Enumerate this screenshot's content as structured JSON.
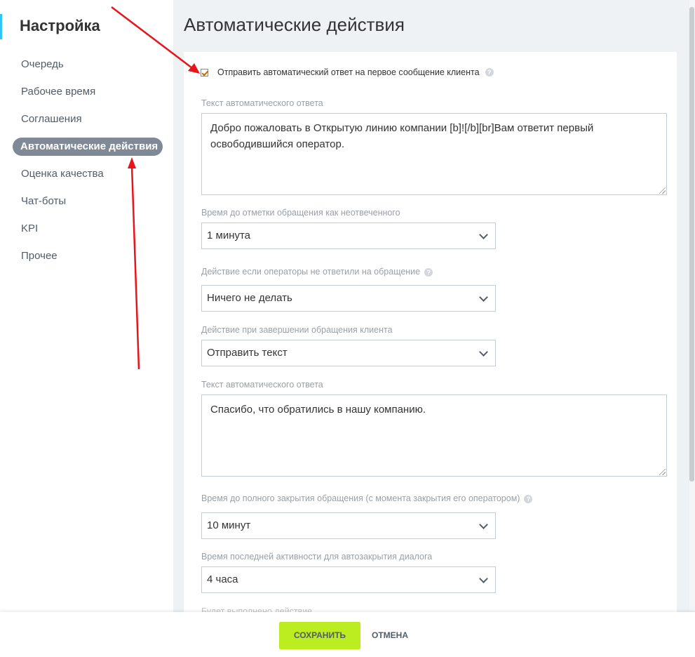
{
  "sidebar": {
    "title": "Настройка",
    "items": [
      {
        "label": "Очередь",
        "active": false
      },
      {
        "label": "Рабочее время",
        "active": false
      },
      {
        "label": "Соглашения",
        "active": false
      },
      {
        "label": "Автоматические действия",
        "active": true
      },
      {
        "label": "Оценка качества",
        "active": false
      },
      {
        "label": "Чат-боты",
        "active": false
      },
      {
        "label": "KPI",
        "active": false
      },
      {
        "label": "Прочее",
        "active": false
      }
    ]
  },
  "main": {
    "title": "Автоматические действия",
    "auto_reply_checkbox": {
      "label": "Отправить автоматический ответ на первое сообщение клиента",
      "checked": true
    },
    "auto_reply_text": {
      "label": "Текст автоматического ответа",
      "value": "Добро пожаловать в Открытую линию компании [b]![/b][br]Вам ответит первый освободившийся оператор."
    },
    "unanswered_time": {
      "label": "Время до отметки обращения как неотвеченного",
      "value": "1 минута"
    },
    "no_answer_action": {
      "label": "Действие если операторы не ответили на обращение",
      "value": "Ничего не делать"
    },
    "finish_action": {
      "label": "Действие при завершении обращения клиента",
      "value": "Отправить текст"
    },
    "finish_text": {
      "label": "Текст автоматического ответа",
      "value": "Спасибо, что обратились в нашу компанию."
    },
    "full_close_time": {
      "label": "Время до полного закрытия обращения (с момента закрытия его оператором)",
      "value": "10 минут"
    },
    "last_activity_time": {
      "label": "Время последней активности для автозакрытия диалога",
      "value": "4 часа"
    },
    "cutoff_label": "Будет выполнено действие"
  },
  "footer": {
    "save_label": "СОХРАНИТЬ",
    "cancel_label": "ОТМЕНА"
  },
  "colors": {
    "accent_green": "#bbed21",
    "active_nav": "#808a97",
    "annotation_arrow": "#e8141b"
  }
}
